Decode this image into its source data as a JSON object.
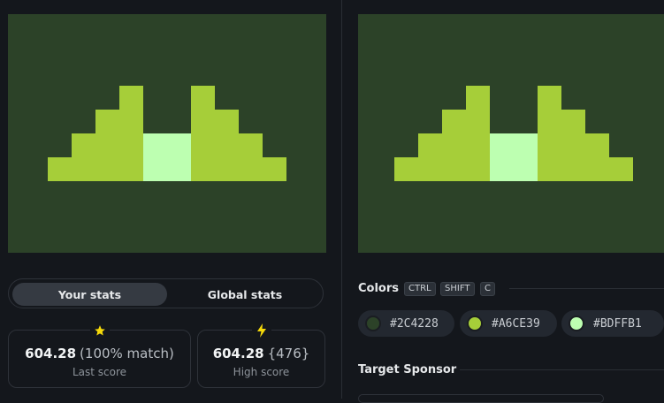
{
  "palette": {
    "bg": "#2C4228",
    "green": "#A6CE39",
    "light": "#BDFFB1"
  },
  "stats": {
    "tabs": {
      "yours": "Your stats",
      "global": "Global stats"
    },
    "last": {
      "score": "604.28",
      "detail": "(100% match)",
      "label": "Last score",
      "icon": "star-icon"
    },
    "high": {
      "score": "604.28",
      "detail": "{476}",
      "label": "High score",
      "icon": "lightning-icon"
    }
  },
  "colors": {
    "title": "Colors",
    "shortcut": [
      "CTRL",
      "SHIFT",
      "C"
    ],
    "swatches": [
      {
        "hex": "#2C4228",
        "color": "#2C4228"
      },
      {
        "hex": "#A6CE39",
        "color": "#A6CE39"
      },
      {
        "hex": "#BDFFB1",
        "color": "#BDFFB1"
      }
    ]
  },
  "sponsor": {
    "title": "Target Sponsor"
  }
}
